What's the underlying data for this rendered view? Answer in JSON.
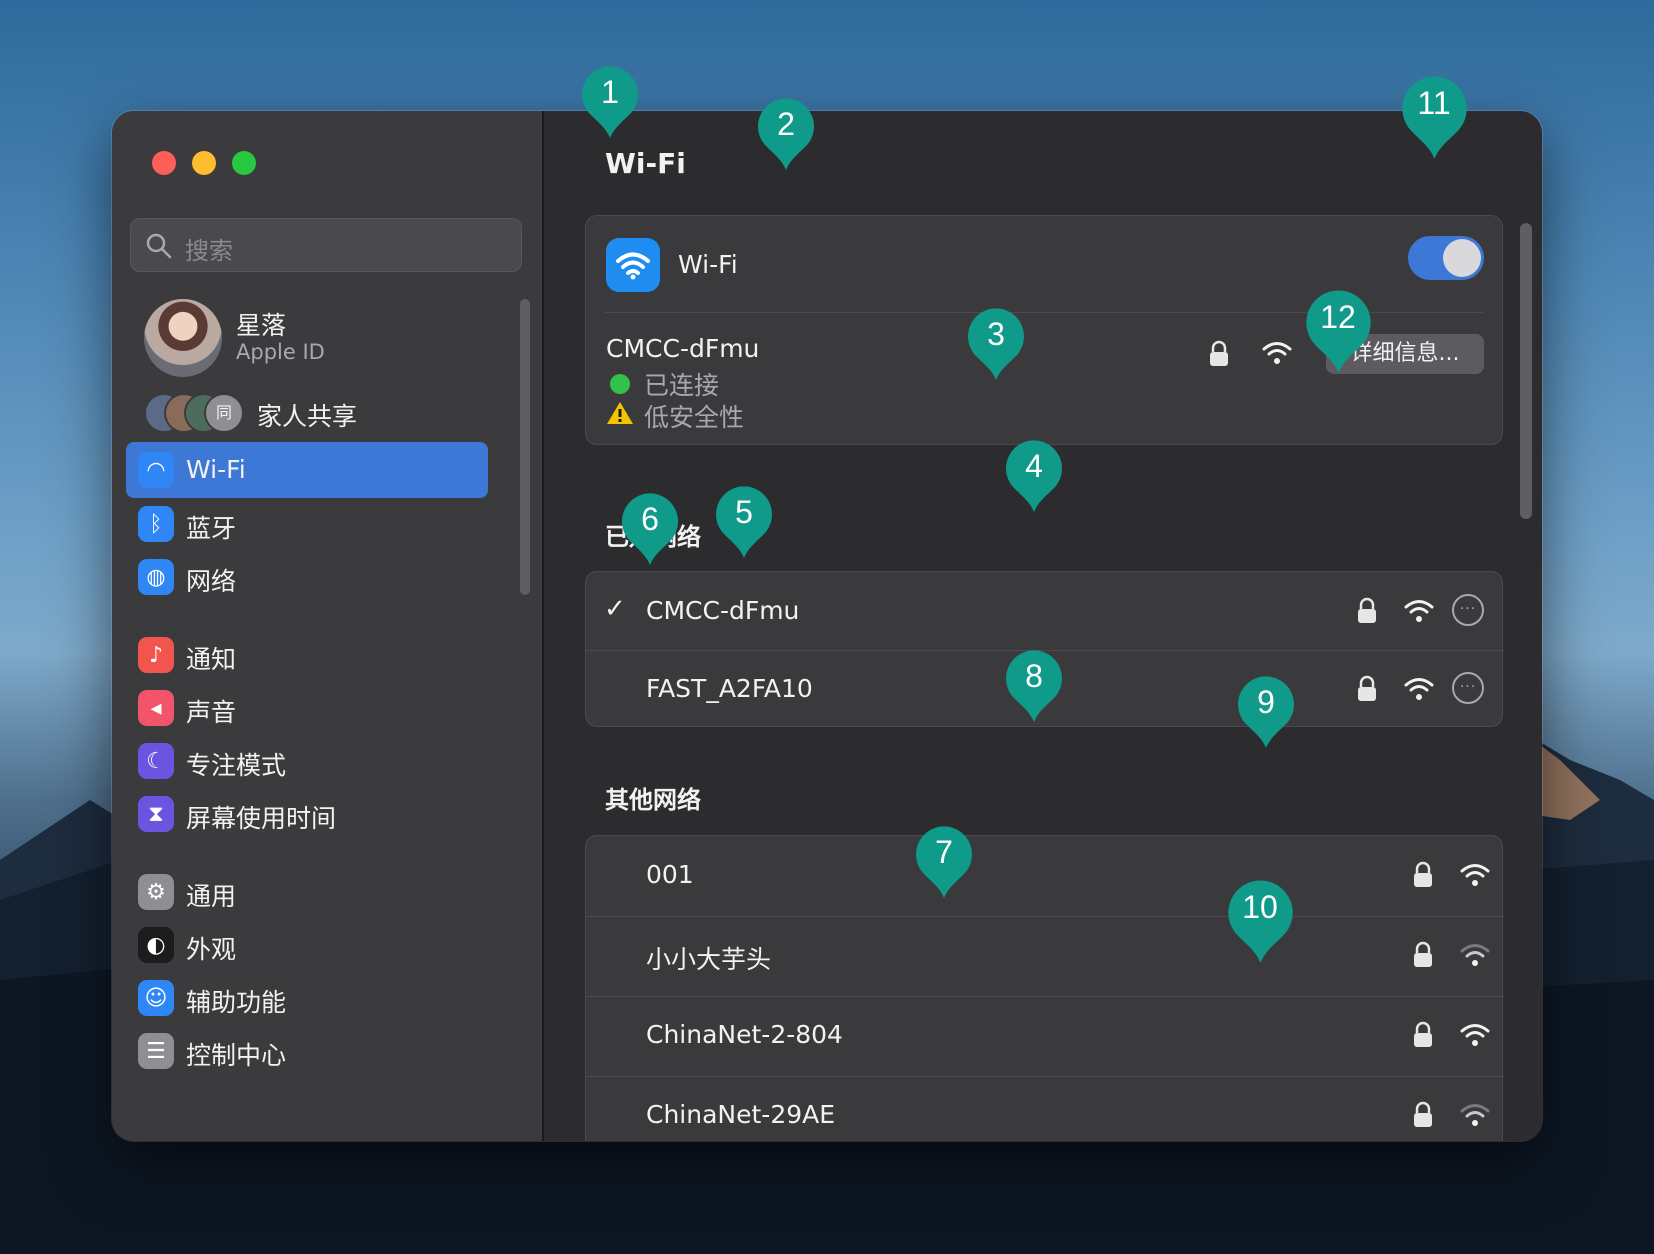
{
  "window": {
    "traffic_lights": [
      {
        "name": "close",
        "color": "#fe5f57"
      },
      {
        "name": "minimize",
        "color": "#febc2e"
      },
      {
        "name": "zoom",
        "color": "#28c840"
      }
    ]
  },
  "sidebar": {
    "search_placeholder": "搜索",
    "profile": {
      "name": "星落",
      "subtitle": "Apple ID"
    },
    "family": {
      "label": "家人共享",
      "avatar_letter": "同"
    },
    "groups": [
      [
        {
          "label": "Wi-Fi",
          "icon": "wifi-icon",
          "color": "#2f86f5",
          "selected": true
        },
        {
          "label": "蓝牙",
          "icon": "bluetooth-icon",
          "color": "#2f86f5"
        },
        {
          "label": "网络",
          "icon": "globe-icon",
          "color": "#2f86f5"
        }
      ],
      [
        {
          "label": "通知",
          "icon": "bell-icon",
          "color": "#f2554e"
        },
        {
          "label": "声音",
          "icon": "speaker-icon",
          "color": "#f2556a"
        },
        {
          "label": "专注模式",
          "icon": "moon-icon",
          "color": "#6a55e0"
        },
        {
          "label": "屏幕使用时间",
          "icon": "hourglass-icon",
          "color": "#6a55e0"
        }
      ],
      [
        {
          "label": "通用",
          "icon": "gear-icon",
          "color": "#8e8e93"
        },
        {
          "label": "外观",
          "icon": "appearance-icon",
          "color": "#1c1c1e"
        },
        {
          "label": "辅助功能",
          "icon": "accessibility-icon",
          "color": "#2f86f5"
        },
        {
          "label": "控制中心",
          "icon": "control-center-icon",
          "color": "#8e8e93"
        }
      ]
    ]
  },
  "main": {
    "title": "Wi-Fi",
    "wifi_toggle": {
      "label": "Wi-Fi",
      "on": true
    },
    "current_network": {
      "name": "CMCC-dFmu",
      "status": "已连接",
      "warning": "低安全性",
      "details_button": "详细信息..."
    },
    "known_section": "已知网络",
    "known_networks": [
      {
        "name": "CMCC-dFmu",
        "connected": true
      },
      {
        "name": "FAST_A2FA10",
        "connected": false
      }
    ],
    "other_section": "其他网络",
    "other_networks": [
      {
        "name": "001",
        "signal": "strong"
      },
      {
        "name": "小小大芋头",
        "signal": "weak"
      },
      {
        "name": "ChinaNet-2-804",
        "signal": "strong"
      },
      {
        "name": "ChinaNet-29AE",
        "signal": "weak"
      }
    ]
  },
  "annotations": {
    "color": "#0f9a8a",
    "labels": [
      "1",
      "2",
      "3",
      "4",
      "5",
      "6",
      "7",
      "8",
      "9",
      "10",
      "11",
      "12"
    ]
  }
}
